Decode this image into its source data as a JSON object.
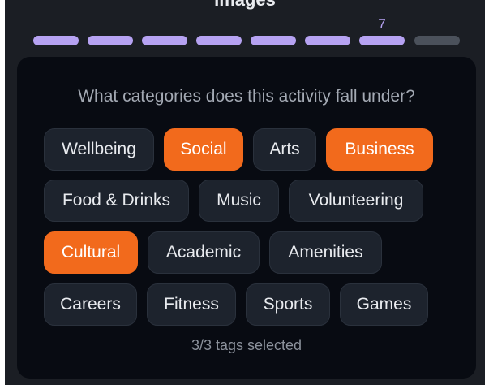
{
  "header": {
    "title": "Images"
  },
  "progress": {
    "current_step_label": "7",
    "segments": [
      {
        "state": "complete"
      },
      {
        "state": "complete"
      },
      {
        "state": "complete"
      },
      {
        "state": "complete"
      },
      {
        "state": "complete"
      },
      {
        "state": "complete"
      },
      {
        "state": "current"
      },
      {
        "state": "incomplete"
      }
    ],
    "active_color": "#b6a2f2",
    "inactive_color": "#4b515b"
  },
  "question": "What categories does this activity fall under?",
  "tags": [
    {
      "label": "Wellbeing",
      "selected": false
    },
    {
      "label": "Social",
      "selected": true
    },
    {
      "label": "Arts",
      "selected": false
    },
    {
      "label": "Business",
      "selected": true
    },
    {
      "label": "Food & Drinks",
      "selected": false
    },
    {
      "label": "Music",
      "selected": false
    },
    {
      "label": "Volunteering",
      "selected": false
    },
    {
      "label": "Cultural",
      "selected": true
    },
    {
      "label": "Academic",
      "selected": false
    },
    {
      "label": "Amenities",
      "selected": false
    },
    {
      "label": "Careers",
      "selected": false
    },
    {
      "label": "Fitness",
      "selected": false
    },
    {
      "label": "Sports",
      "selected": false
    },
    {
      "label": "Games",
      "selected": false
    }
  ],
  "selection_status": "3/3 tags selected",
  "colors": {
    "accent": "#f26a1c",
    "background": "#1b1e24",
    "card": "#080b12",
    "tag": "#1d232d"
  }
}
